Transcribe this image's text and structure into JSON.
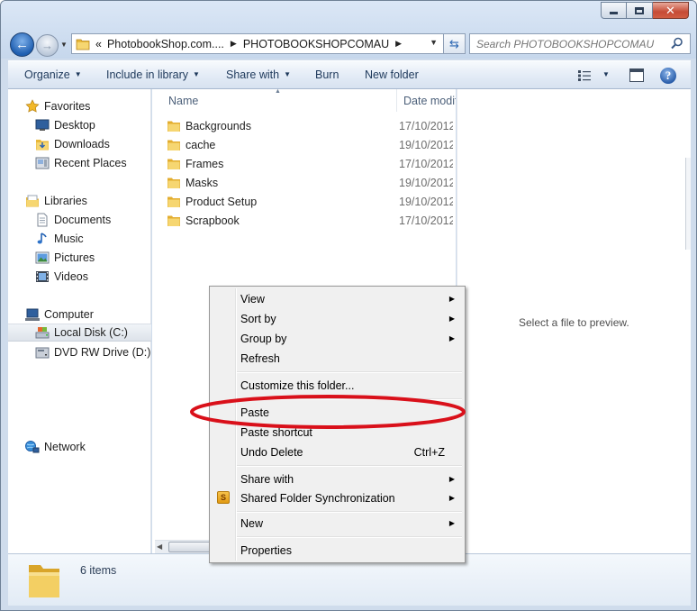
{
  "window": {
    "address": {
      "overflow_glyph": "«",
      "crumbs": [
        "PhotobookShop.com....",
        "PHOTOBOOKSHOPCOMAU"
      ]
    },
    "search": {
      "placeholder": "Search PHOTOBOOKSHOPCOMAU"
    }
  },
  "toolbar": {
    "organize": "Organize",
    "include_in_library": "Include in library",
    "share_with": "Share with",
    "burn": "Burn",
    "new_folder": "New folder"
  },
  "nav": {
    "favorites": "Favorites",
    "desktop": "Desktop",
    "downloads": "Downloads",
    "recent_places": "Recent Places",
    "libraries": "Libraries",
    "documents": "Documents",
    "music": "Music",
    "pictures": "Pictures",
    "videos": "Videos",
    "computer": "Computer",
    "local_disk": "Local Disk (C:)",
    "dvd_drive": "DVD RW Drive (D:) C",
    "network": "Network"
  },
  "columns": {
    "name": "Name",
    "date": "Date modifi"
  },
  "files": [
    {
      "name": "Backgrounds",
      "date": "17/10/2012"
    },
    {
      "name": "cache",
      "date": "19/10/2012"
    },
    {
      "name": "Frames",
      "date": "17/10/2012"
    },
    {
      "name": "Masks",
      "date": "19/10/2012"
    },
    {
      "name": "Product Setup",
      "date": "19/10/2012"
    },
    {
      "name": "Scrapbook",
      "date": "17/10/2012"
    }
  ],
  "preview": {
    "message": "Select a file to preview."
  },
  "details": {
    "item_count": "6 items"
  },
  "context_menu": {
    "view": "View",
    "sort_by": "Sort by",
    "group_by": "Group by",
    "refresh": "Refresh",
    "customize": "Customize this folder...",
    "paste": "Paste",
    "paste_shortcut": "Paste shortcut",
    "undo_delete": "Undo Delete",
    "undo_shortcut": "Ctrl+Z",
    "share_with": "Share with",
    "shared_sync": "Shared Folder Synchronization",
    "shared_sync_icon_letter": "S",
    "new": "New",
    "properties": "Properties"
  },
  "colors": {
    "accent_blue": "#1f5fb1",
    "folder_yellow": "#f2c94c",
    "annotation_red": "#d9101a"
  }
}
